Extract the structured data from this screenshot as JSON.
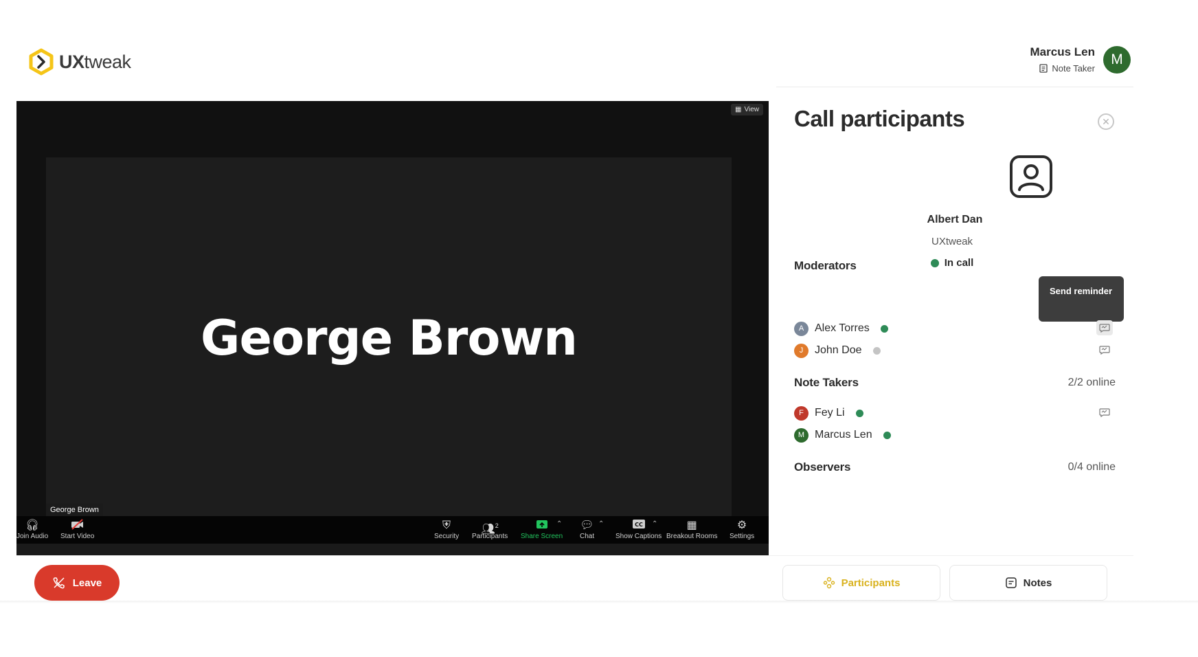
{
  "brand": {
    "name_bold": "UX",
    "name_rest": "tweak",
    "accent": "#F5C518"
  },
  "user": {
    "name": "Marcus Len",
    "role": "Note Taker",
    "avatar_letter": "M",
    "avatar_color": "#2E6B2E"
  },
  "video": {
    "view_label": "View",
    "speaker_name": "George Brown",
    "name_tag": "George Brown",
    "toolbar": {
      "join_audio": "Join Audio",
      "start_video": "Start Video",
      "security": "Security",
      "participants": "Participants",
      "participants_count": "2",
      "share_screen": "Share Screen",
      "chat": "Chat",
      "show_captions": "Show Captions",
      "breakout_rooms": "Breakout Rooms",
      "settings": "Settings"
    }
  },
  "panel": {
    "title": "Call participants",
    "host": {
      "name": "Albert Dan",
      "org": "UXtweak",
      "status": "In call"
    },
    "tooltip": "Send reminder",
    "moderators": {
      "title": "Moderators",
      "people": [
        {
          "initial": "A",
          "name": "Alex Torres",
          "online": true,
          "color": "#7A8799"
        },
        {
          "initial": "J",
          "name": "John Doe",
          "online": false,
          "color": "#E07A2B"
        }
      ]
    },
    "note_takers": {
      "title": "Note Takers",
      "count": "2/2 online",
      "people": [
        {
          "initial": "F",
          "name": "Fey Li",
          "online": true,
          "color": "#C0392B"
        },
        {
          "initial": "M",
          "name": "Marcus Len",
          "online": true,
          "color": "#2E6B2E"
        }
      ]
    },
    "observers": {
      "title": "Observers",
      "count": "0/4 online"
    }
  },
  "footer": {
    "leave": "Leave",
    "participants_tab": "Participants",
    "notes_tab": "Notes"
  },
  "colors": {
    "online": "#2E8B57",
    "offline": "#C4C4C4",
    "leave": "#D93A2B",
    "active_tab": "#D9B21E"
  }
}
